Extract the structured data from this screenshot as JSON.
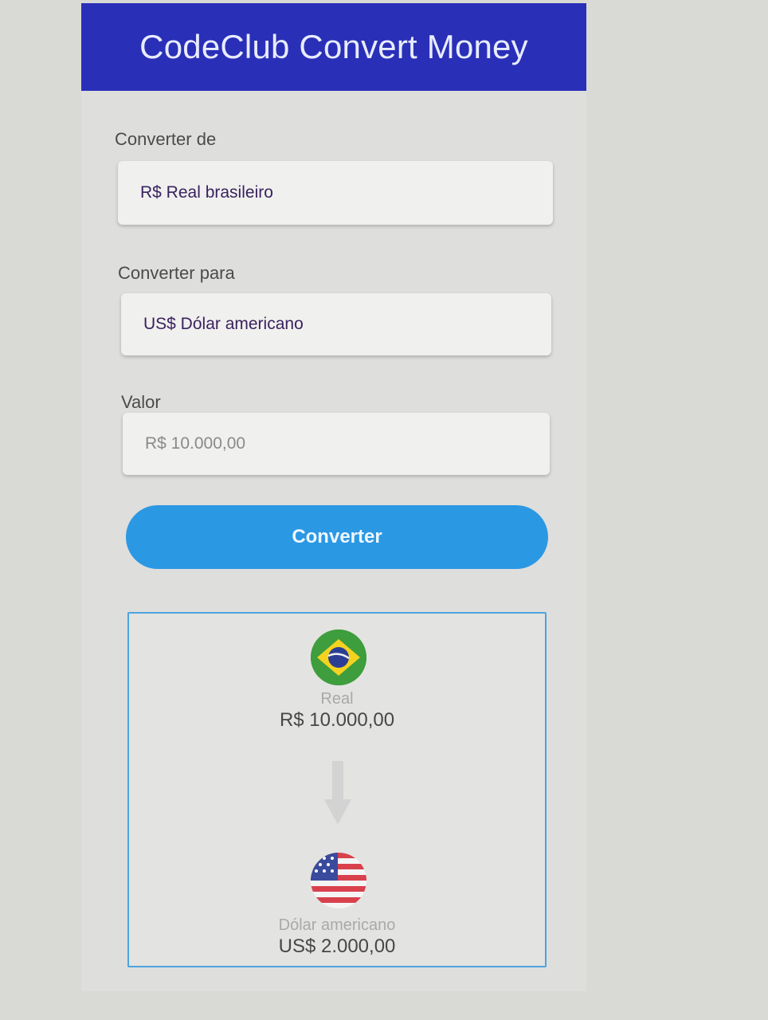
{
  "header": {
    "title": "CodeClub Convert Money"
  },
  "form": {
    "from_label": "Converter de",
    "from_value": "R$ Real brasileiro",
    "to_label": "Converter para",
    "to_value": "US$ Dólar americano",
    "amount_label": "Valor",
    "amount_placeholder": "R$ 10.000,00",
    "convert_button": "Converter"
  },
  "result": {
    "from_currency_name": "Real",
    "from_amount": "R$ 10.000,00",
    "from_flag_icon": "brazil-flag-icon",
    "arrow_icon": "arrow-down-icon",
    "to_currency_name": "Dólar americano",
    "to_amount": "US$ 2.000,00",
    "to_flag_icon": "us-flag-icon"
  },
  "colors": {
    "header_bg": "#2a2fb8",
    "button_bg": "#2b98e4",
    "result_border": "#4ea3de"
  }
}
